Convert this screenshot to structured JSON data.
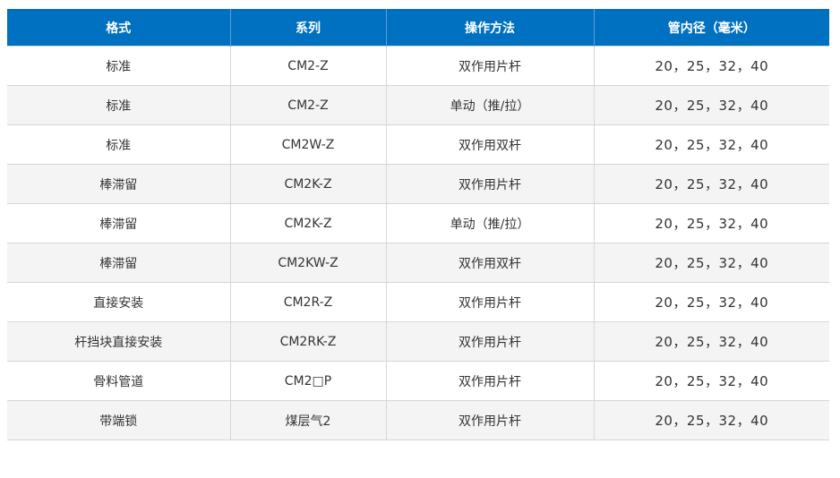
{
  "table": {
    "headers": [
      "格式",
      "系列",
      "操作方法",
      "管内径（毫米）"
    ],
    "rows": [
      [
        "标准",
        "CM2-Z",
        "双作用片杆",
        "20，25，32，40"
      ],
      [
        "标准",
        "CM2-Z",
        "单动（推/拉）",
        "20，25，32，40"
      ],
      [
        "标准",
        "CM2W-Z",
        "双作用双杆",
        "20，25，32，40"
      ],
      [
        "棒滞留",
        "CM2K-Z",
        "双作用片杆",
        "20，25，32，40"
      ],
      [
        "棒滞留",
        "CM2K-Z",
        "单动（推/拉）",
        "20，25，32，40"
      ],
      [
        "棒滞留",
        "CM2KW-Z",
        "双作用双杆",
        "20，25，32，40"
      ],
      [
        "直接安装",
        "CM2R-Z",
        "双作用片杆",
        "20，25，32，40"
      ],
      [
        "杆挡块直接安装",
        "CM2RK-Z",
        "双作用片杆",
        "20，25，32，40"
      ],
      [
        "骨料管道",
        "CM2□P",
        "双作用片杆",
        "20，25，32，40"
      ],
      [
        "带端锁",
        "煤层气2",
        "双作用片杆",
        "20，25，32，40"
      ]
    ]
  },
  "colors": {
    "header_bg": "#0070c0",
    "header_text": "#ffffff",
    "stripe_bg": "#f4f4f4",
    "border": "#d6d6d6"
  }
}
